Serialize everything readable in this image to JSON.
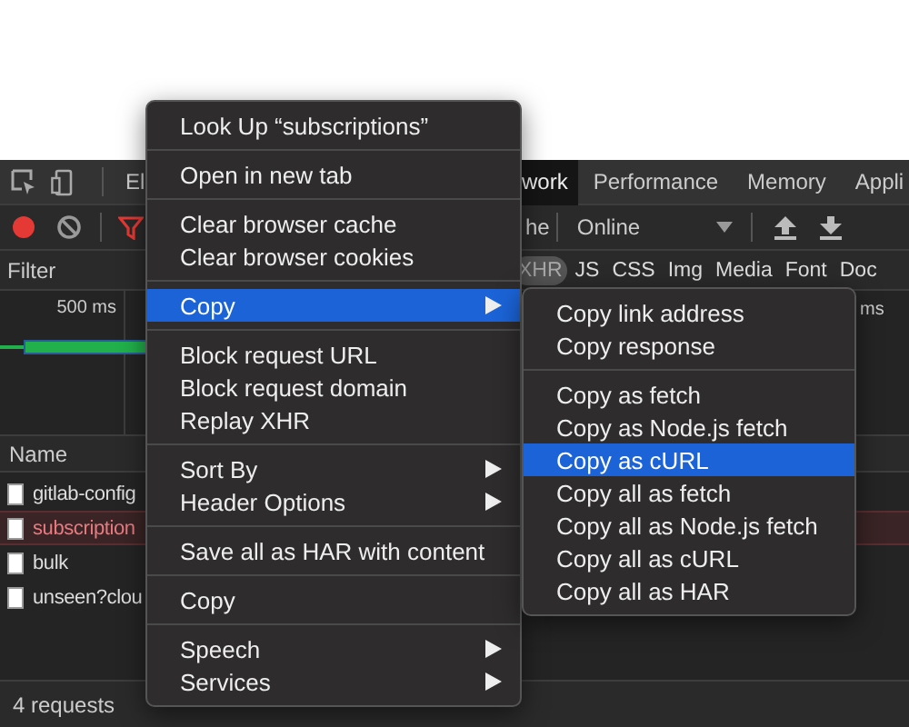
{
  "tabs": [
    {
      "label": "El",
      "selected": false
    },
    {
      "label": "work",
      "selected": true
    },
    {
      "label": "Performance",
      "selected": false
    },
    {
      "label": "Memory",
      "selected": false
    },
    {
      "label": "Appli",
      "selected": false
    }
  ],
  "toolbar": {
    "recording": true,
    "cache_label": "he",
    "throttling": "Online"
  },
  "filter": {
    "placeholder": "Filter",
    "types": [
      {
        "label": "XHR",
        "selected": true
      },
      {
        "label": "JS",
        "selected": false
      },
      {
        "label": "CSS",
        "selected": false
      },
      {
        "label": "Img",
        "selected": false
      },
      {
        "label": "Media",
        "selected": false
      },
      {
        "label": "Font",
        "selected": false
      },
      {
        "label": "Doc",
        "selected": false
      }
    ]
  },
  "timeline": {
    "ticks": [
      "500 ms",
      "ms"
    ]
  },
  "requests": {
    "column": "Name",
    "rows": [
      {
        "name": "gitlab-config",
        "selected": false
      },
      {
        "name": "subscription",
        "selected": true
      },
      {
        "name": "bulk",
        "selected": false
      },
      {
        "name": "unseen?clou",
        "selected": false
      }
    ]
  },
  "status_bar": "4 requests",
  "context_menu": {
    "items": [
      {
        "kind": "item",
        "label": "Look Up “subscriptions”",
        "selected": false
      },
      {
        "kind": "separator"
      },
      {
        "kind": "item",
        "label": "Open in new tab",
        "selected": false
      },
      {
        "kind": "separator"
      },
      {
        "kind": "item",
        "label": "Clear browser cache",
        "selected": false
      },
      {
        "kind": "item",
        "label": "Clear browser cookies",
        "selected": false
      },
      {
        "kind": "separator"
      },
      {
        "kind": "submenu",
        "label": "Copy",
        "selected": true
      },
      {
        "kind": "separator"
      },
      {
        "kind": "item",
        "label": "Block request URL",
        "selected": false
      },
      {
        "kind": "item",
        "label": "Block request domain",
        "selected": false
      },
      {
        "kind": "item",
        "label": "Replay XHR",
        "selected": false
      },
      {
        "kind": "separator"
      },
      {
        "kind": "submenu",
        "label": "Sort By",
        "selected": false
      },
      {
        "kind": "submenu",
        "label": "Header Options",
        "selected": false
      },
      {
        "kind": "separator"
      },
      {
        "kind": "item",
        "label": "Save all as HAR with content",
        "selected": false
      },
      {
        "kind": "separator"
      },
      {
        "kind": "item",
        "label": "Copy",
        "selected": false
      },
      {
        "kind": "separator"
      },
      {
        "kind": "submenu",
        "label": "Speech",
        "selected": false
      },
      {
        "kind": "submenu",
        "label": "Services",
        "selected": false
      }
    ]
  },
  "copy_submenu": {
    "items": [
      {
        "kind": "item",
        "label": "Copy link address",
        "selected": false
      },
      {
        "kind": "item",
        "label": "Copy response",
        "selected": false
      },
      {
        "kind": "separator"
      },
      {
        "kind": "item",
        "label": "Copy as fetch",
        "selected": false
      },
      {
        "kind": "item",
        "label": "Copy as Node.js fetch",
        "selected": false
      },
      {
        "kind": "item",
        "label": "Copy as cURL",
        "selected": true
      },
      {
        "kind": "item",
        "label": "Copy all as fetch",
        "selected": false
      },
      {
        "kind": "item",
        "label": "Copy all as Node.js fetch",
        "selected": false
      },
      {
        "kind": "item",
        "label": "Copy all as cURL",
        "selected": false
      },
      {
        "kind": "item",
        "label": "Copy all as HAR",
        "selected": false
      }
    ]
  }
}
